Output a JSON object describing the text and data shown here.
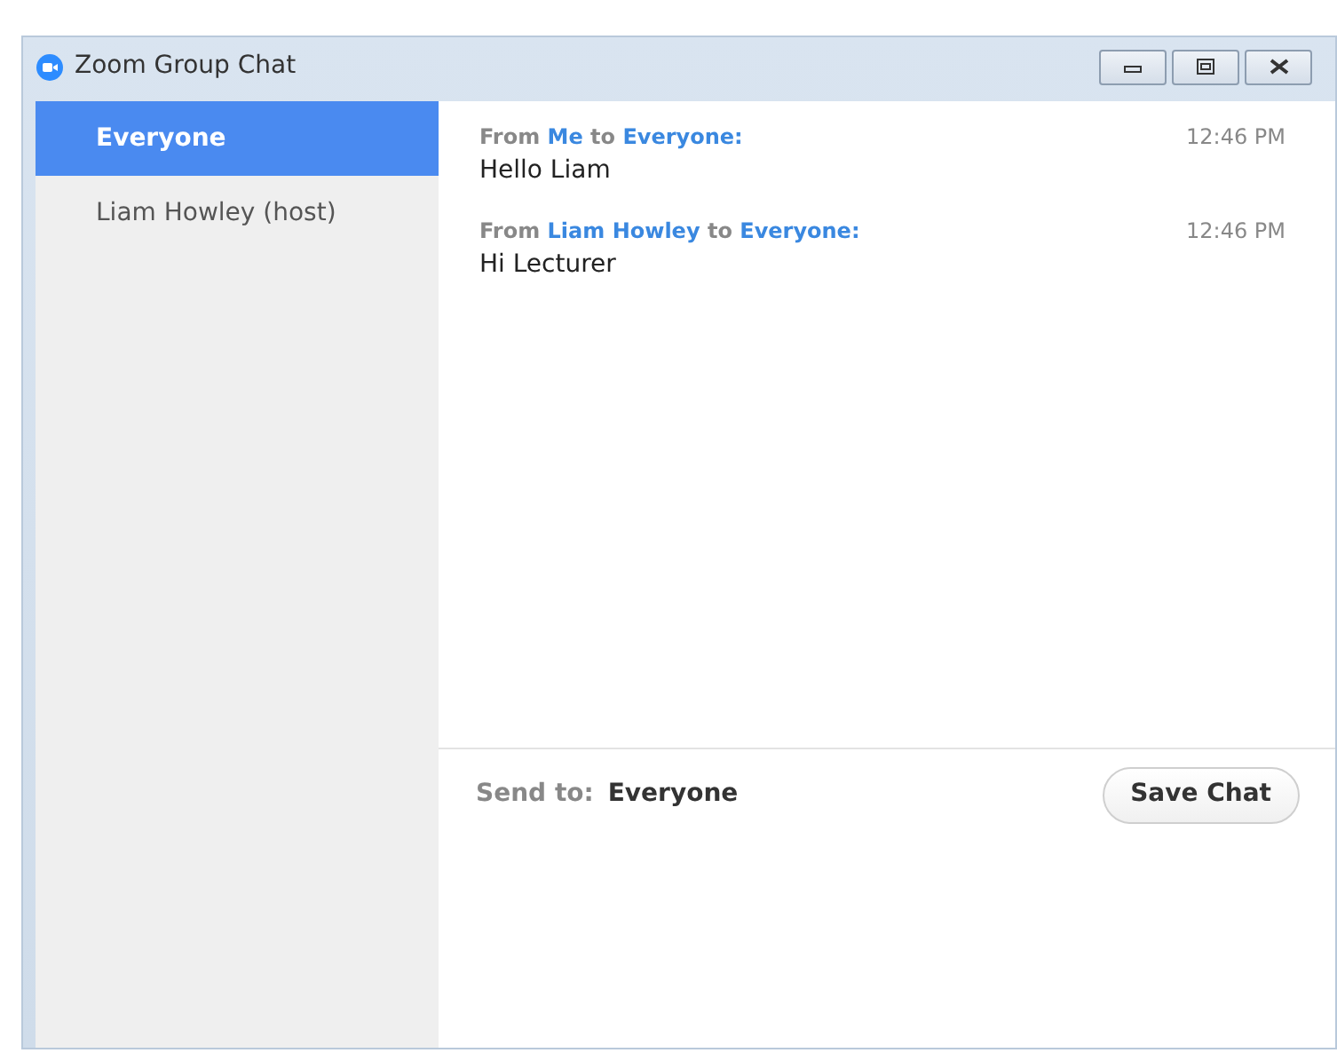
{
  "window": {
    "title": "Zoom Group Chat"
  },
  "recipients": [
    {
      "label": "Everyone",
      "selected": true
    },
    {
      "label": "Liam Howley (host)",
      "selected": false
    }
  ],
  "messages": [
    {
      "header": [
        {
          "kind": "plain",
          "text": "From "
        },
        {
          "kind": "name",
          "text": "Me"
        },
        {
          "kind": "plain",
          "text": " to "
        },
        {
          "kind": "name",
          "text": "Everyone:"
        }
      ],
      "time": "12:46 PM",
      "text": "Hello Liam"
    },
    {
      "header": [
        {
          "kind": "plain",
          "text": "From "
        },
        {
          "kind": "name",
          "text": "Liam Howley"
        },
        {
          "kind": "plain",
          "text": " to "
        },
        {
          "kind": "name",
          "text": "Everyone:"
        }
      ],
      "time": "12:46 PM",
      "text": "Hi Lecturer"
    }
  ],
  "send_to": {
    "label": "Send to:",
    "value": "Everyone"
  },
  "save_button": "Save Chat"
}
